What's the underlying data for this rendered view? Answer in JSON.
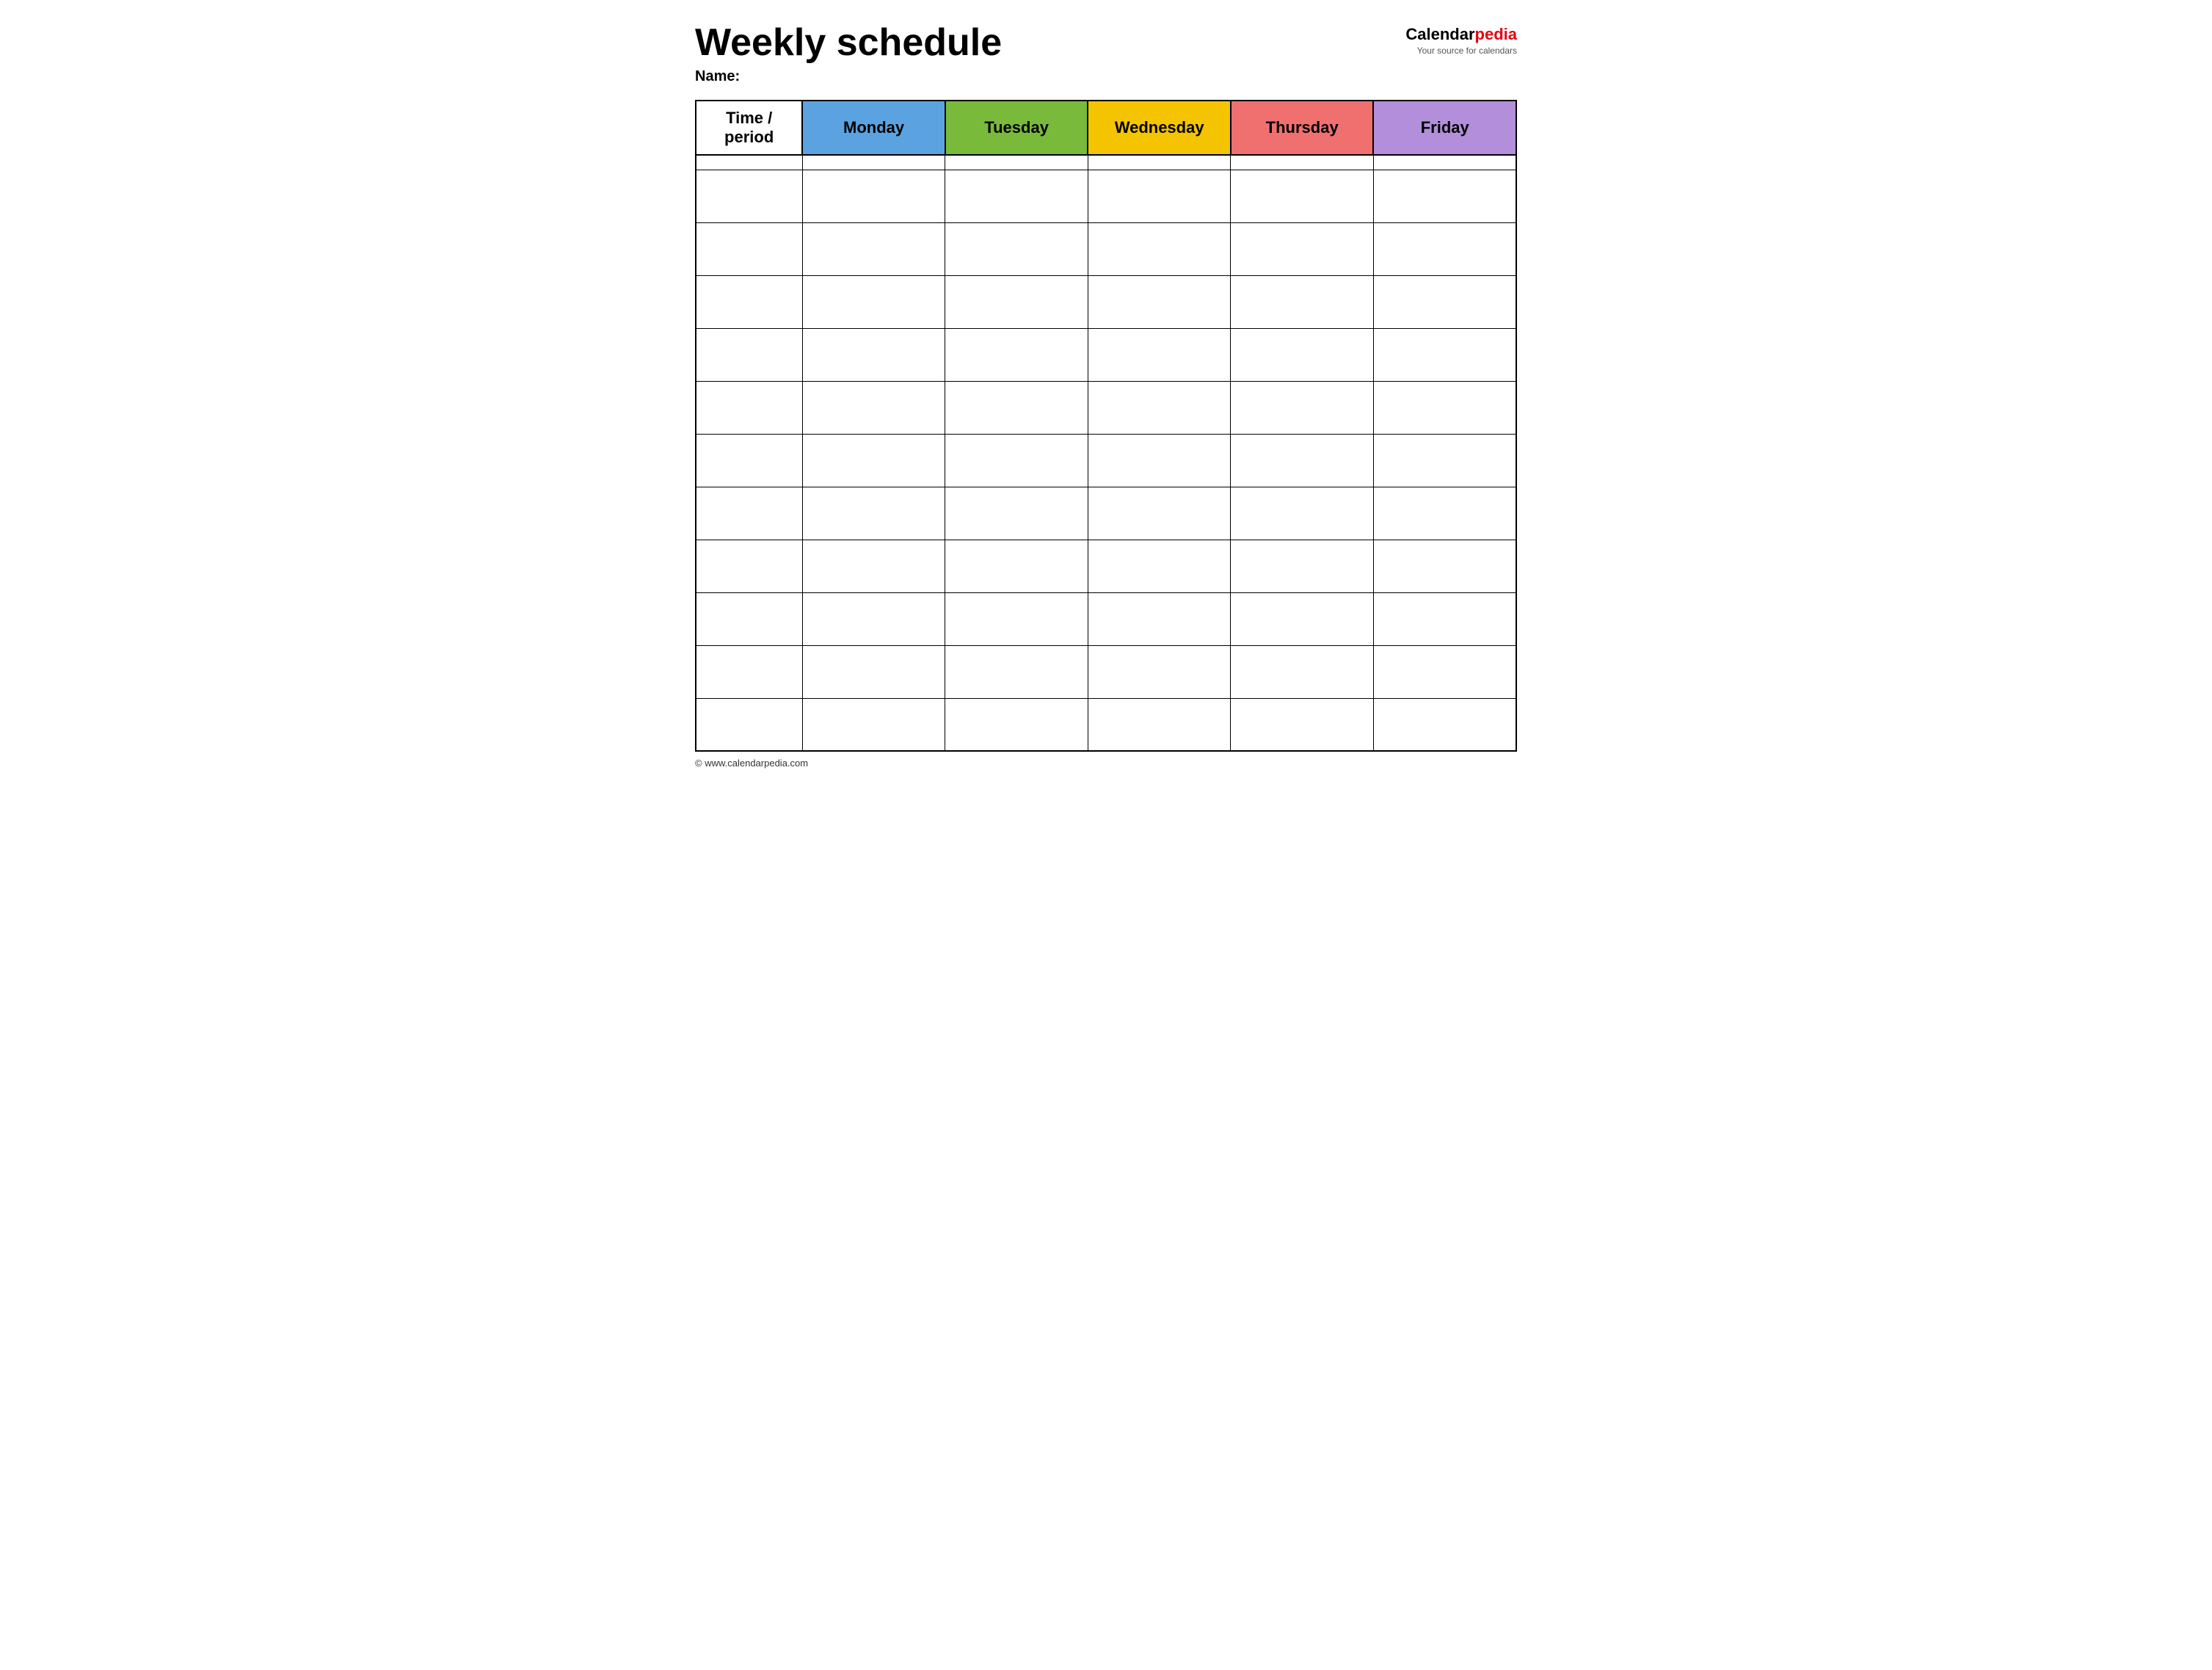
{
  "header": {
    "title": "Weekly schedule",
    "name_label": "Name:",
    "logo": {
      "part1": "Calendar",
      "part2": "pedia",
      "tagline": "Your source for calendars"
    }
  },
  "table": {
    "columns": [
      {
        "id": "time",
        "label": "Time / period",
        "color": "#ffffff"
      },
      {
        "id": "monday",
        "label": "Monday",
        "color": "#5ba3e0"
      },
      {
        "id": "tuesday",
        "label": "Tuesday",
        "color": "#7aba3a"
      },
      {
        "id": "wednesday",
        "label": "Wednesday",
        "color": "#f5c400"
      },
      {
        "id": "thursday",
        "label": "Thursday",
        "color": "#f07070"
      },
      {
        "id": "friday",
        "label": "Friday",
        "color": "#b38fdb"
      }
    ],
    "row_count": 12
  },
  "footer": {
    "url": "© www.calendarpedia.com"
  }
}
